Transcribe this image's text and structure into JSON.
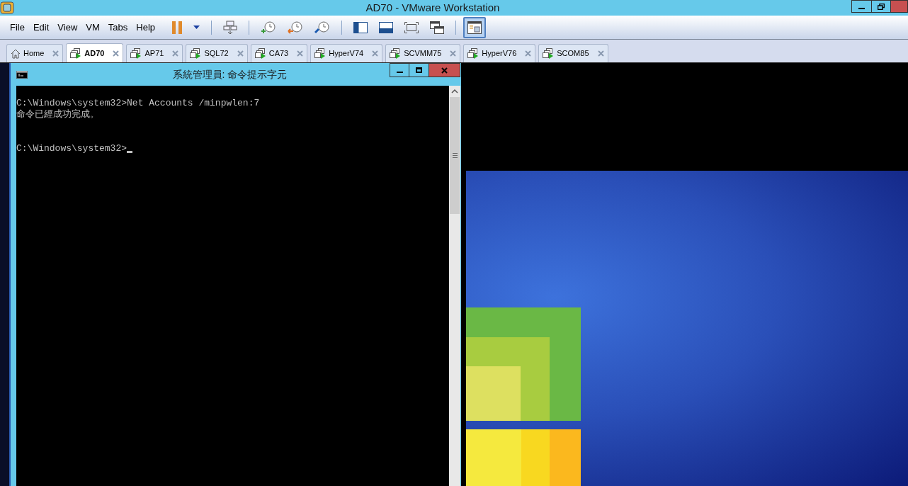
{
  "window": {
    "title": "AD70 - VMware Workstation"
  },
  "menu": [
    "File",
    "Edit",
    "View",
    "VM",
    "Tabs",
    "Help"
  ],
  "toolbar": [
    [
      {
        "kind": "pause",
        "selected": false
      },
      {
        "kind": "caret",
        "selected": false
      }
    ],
    [
      {
        "kind": "keys",
        "selected": false
      }
    ],
    [
      {
        "kind": "snap-add",
        "selected": false
      },
      {
        "kind": "snap-revert",
        "selected": false
      },
      {
        "kind": "snap-manage",
        "selected": false
      }
    ],
    [
      {
        "kind": "sidebar",
        "selected": false
      },
      {
        "kind": "bottombar",
        "selected": false
      },
      {
        "kind": "fullscreen",
        "selected": false
      },
      {
        "kind": "windows",
        "selected": false
      }
    ],
    [
      {
        "kind": "console",
        "selected": true
      }
    ]
  ],
  "tabs": [
    {
      "label": "Home",
      "kind": "home",
      "selected": false
    },
    {
      "label": "AD70",
      "kind": "vm",
      "selected": true
    },
    {
      "label": "AP71",
      "kind": "vm",
      "selected": false
    },
    {
      "label": "SQL72",
      "kind": "vm",
      "selected": false
    },
    {
      "label": "CA73",
      "kind": "vm",
      "selected": false
    },
    {
      "label": "HyperV74",
      "kind": "vm",
      "selected": false
    },
    {
      "label": "SCVMM75",
      "kind": "vm",
      "selected": false
    },
    {
      "label": "HyperV76",
      "kind": "vm",
      "selected": false
    },
    {
      "label": "SCOM85",
      "kind": "vm",
      "selected": false
    }
  ],
  "console": {
    "title": "系統管理員: 命令提示字元",
    "lines": [
      "C:\\Windows\\system32>Net Accounts /minpwlen:7",
      "命令已經成功完成。"
    ],
    "prompt": "C:\\Windows\\system32>"
  }
}
